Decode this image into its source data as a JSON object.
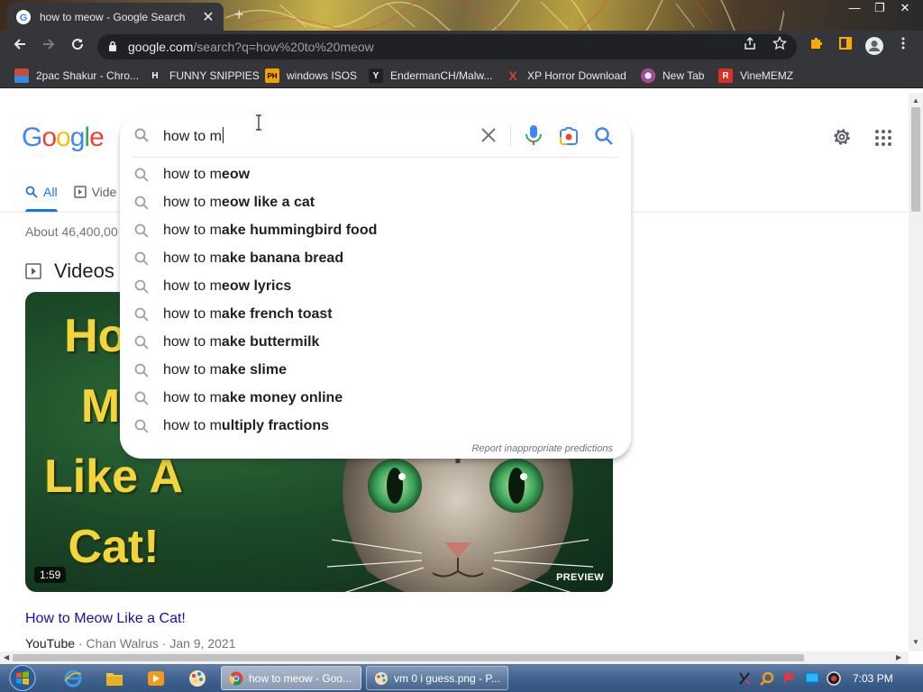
{
  "browser": {
    "tab": {
      "title": "how to meow - Google Search",
      "close_glyph": "✕"
    },
    "new_tab_glyph": "+",
    "window_controls": {
      "minimize": "—",
      "restore": "❐",
      "close": "✕"
    },
    "address": {
      "host": "google.com",
      "path": "/search?q=how%20to%20meow"
    }
  },
  "bookmarks": [
    {
      "label": "2pac Shakur - Chro...",
      "icon": "drive-icon",
      "color": "#c94a3a",
      "mark": ""
    },
    {
      "label": "FUNNY SNIPPIES",
      "icon": "h-icon",
      "color": "#35363a",
      "mark": "H"
    },
    {
      "label": "windows ISOS",
      "icon": "ph-icon",
      "color": "#f4a000",
      "mark": "PH"
    },
    {
      "label": "EndermanCH/Malw...",
      "icon": "yp-icon",
      "color": "#202124",
      "mark": "Y"
    },
    {
      "label": "XP Horror Download",
      "icon": "x-icon",
      "color": "#35363a",
      "mark": "X"
    },
    {
      "label": "New Tab",
      "icon": "newtab-icon",
      "color": "#7a4aa0",
      "mark": ""
    },
    {
      "label": "VineMEMZ",
      "icon": "r-icon",
      "color": "#d93025",
      "mark": "R"
    }
  ],
  "google": {
    "logo": [
      "G",
      "o",
      "o",
      "g",
      "l",
      "e"
    ],
    "search": {
      "typed": "how to m",
      "report_label": "Report inappropriate predictions"
    },
    "suggestions": [
      {
        "prefix": "how to m",
        "completion": "eow"
      },
      {
        "prefix": "how to m",
        "completion": "eow like a cat"
      },
      {
        "prefix": "how to m",
        "completion": "ake hummingbird food"
      },
      {
        "prefix": "how to m",
        "completion": "ake banana bread"
      },
      {
        "prefix": "how to m",
        "completion": "eow lyrics"
      },
      {
        "prefix": "how to m",
        "completion": "ake french toast"
      },
      {
        "prefix": "how to m",
        "completion": "ake buttermilk"
      },
      {
        "prefix": "how to m",
        "completion": "ake slime"
      },
      {
        "prefix": "how to m",
        "completion": "ake money online"
      },
      {
        "prefix": "how to m",
        "completion": "ultiply fractions"
      }
    ],
    "tabs": [
      {
        "label": "All",
        "active": true
      },
      {
        "label": "Vide",
        "active": false
      }
    ],
    "result_stats": "About 46,400,00",
    "videos_heading": "Videos",
    "video": {
      "thumb_text": [
        "How",
        "Me",
        "Like A",
        "Cat!"
      ],
      "duration": "1:59",
      "preview_label": "PREVIEW",
      "title": "How to Meow Like a Cat!",
      "source": "YouTube",
      "channel": "Chan Walrus",
      "date": "Jan 9, 2021",
      "sep": "·"
    }
  },
  "taskbar": {
    "buttons": [
      {
        "label": "how to meow - Goo...",
        "active": true
      },
      {
        "label": "vm 0 i guess.png - P...",
        "active": false
      }
    ],
    "clock": "7:03 PM"
  },
  "colors": {
    "chrome_dark": "#35363a",
    "google_blue": "#4285f4",
    "link": "#1a0dab",
    "accent": "#1a73e8"
  }
}
